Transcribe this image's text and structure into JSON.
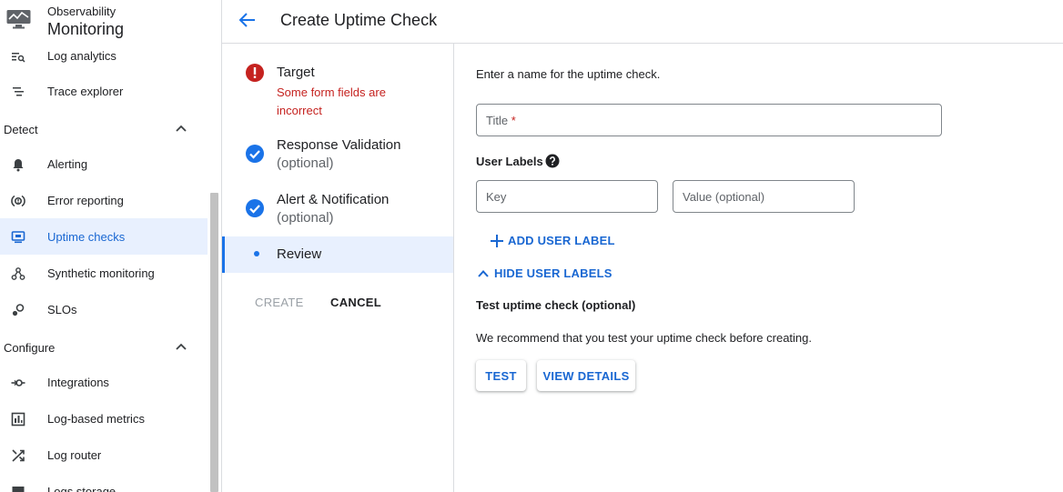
{
  "app": {
    "subtitle": "Observability",
    "title": "Monitoring"
  },
  "nav": {
    "items_top": [
      {
        "label": "Log analytics",
        "icon": "log-analytics-icon"
      },
      {
        "label": "Trace explorer",
        "icon": "trace-explorer-icon"
      }
    ],
    "sections": [
      {
        "label": "Detect",
        "expanded": true,
        "items": [
          {
            "label": "Alerting",
            "icon": "bell-icon"
          },
          {
            "label": "Error reporting",
            "icon": "error-reporting-icon"
          },
          {
            "label": "Uptime checks",
            "icon": "uptime-monitor-icon",
            "active": true
          },
          {
            "label": "Synthetic monitoring",
            "icon": "synthetic-monitoring-icon"
          },
          {
            "label": "SLOs",
            "icon": "slo-icon"
          }
        ]
      },
      {
        "label": "Configure",
        "expanded": true,
        "items": [
          {
            "label": "Integrations",
            "icon": "integrations-icon"
          },
          {
            "label": "Log-based metrics",
            "icon": "log-metrics-icon"
          },
          {
            "label": "Log router",
            "icon": "log-router-icon"
          },
          {
            "label": "Logs storage",
            "icon": "logs-storage-icon"
          }
        ]
      }
    ]
  },
  "header": {
    "title": "Create Uptime Check"
  },
  "stepper": {
    "steps": [
      {
        "title": "Target",
        "status": "error",
        "error": "Some form fields are incorrect"
      },
      {
        "title": "Response Validation",
        "subtitle": "(optional)",
        "status": "complete"
      },
      {
        "title": "Alert & Notification",
        "subtitle": "(optional)",
        "status": "complete"
      },
      {
        "title": "Review",
        "status": "current"
      }
    ],
    "create_label": "CREATE",
    "cancel_label": "CANCEL"
  },
  "form": {
    "intro": "Enter a name for the uptime check.",
    "title_placeholder": "Title",
    "title_required_mark": "*",
    "title_value": "",
    "user_labels_heading": "User Labels",
    "key_placeholder": "Key",
    "value_placeholder": "Value (optional)",
    "add_user_label": "ADD USER LABEL",
    "hide_user_labels": "HIDE USER LABELS",
    "test_heading": "Test uptime check (optional)",
    "test_description": "We recommend that you test your uptime check before creating.",
    "test_button": "TEST",
    "view_details_button": "VIEW DETAILS"
  },
  "colors": {
    "accent": "#1a73e8",
    "link": "#1967d2",
    "error": "#c5221f",
    "active_bg": "#e8f0fe",
    "divider": "#dadce0"
  }
}
